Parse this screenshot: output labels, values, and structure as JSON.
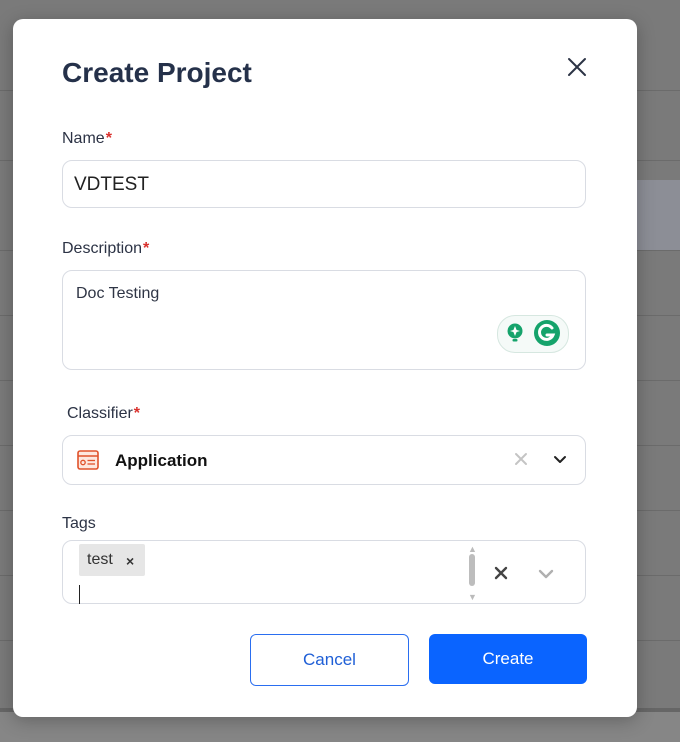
{
  "modal": {
    "title": "Create Project",
    "close_icon": "close-icon"
  },
  "fields": {
    "name": {
      "label": "Name",
      "required_mark": "*",
      "value": "VDTEST"
    },
    "description": {
      "label": "Description",
      "required_mark": "*",
      "value": "Doc Testing"
    },
    "classifier": {
      "label": "Classifier",
      "required_mark": "*",
      "value": "Application",
      "icon": "application-icon"
    },
    "tags": {
      "label": "Tags",
      "chips": [
        {
          "label": "test",
          "remove": "×"
        }
      ]
    }
  },
  "buttons": {
    "cancel_label": "Cancel",
    "create_label": "Create"
  },
  "colors": {
    "primary": "#0a64ff",
    "required": "#d9302c",
    "title": "#25314a",
    "grammarly": "#15a36b"
  }
}
